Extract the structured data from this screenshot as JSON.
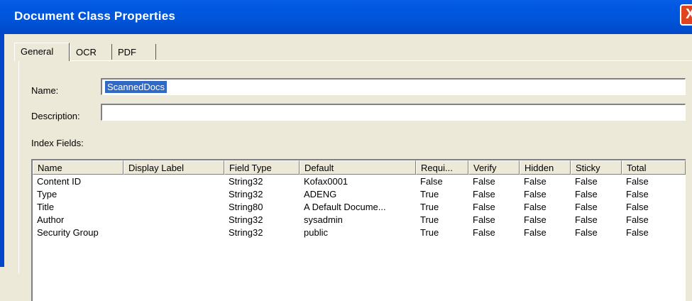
{
  "window": {
    "title": "Document Class Properties",
    "close_label": "X"
  },
  "tabs": [
    {
      "label": "General"
    },
    {
      "label": "OCR"
    },
    {
      "label": "PDF"
    }
  ],
  "form": {
    "name_label": "Name:",
    "name_value": "ScannedDocs",
    "description_label": "Description:",
    "description_value": "",
    "index_fields_label": "Index Fields:"
  },
  "table": {
    "columns": [
      "Name",
      "Display Label",
      "Field Type",
      "Default",
      "Requi...",
      "Verify",
      "Hidden",
      "Sticky",
      "Total"
    ],
    "rows": [
      [
        "Content ID",
        "",
        "String32",
        "Kofax0001",
        "False",
        "False",
        "False",
        "False",
        "False"
      ],
      [
        "Type",
        "",
        "String32",
        "ADENG",
        "True",
        "False",
        "False",
        "False",
        "False"
      ],
      [
        "Title",
        "",
        "String80",
        "A Default Docume...",
        "True",
        "False",
        "False",
        "False",
        "False"
      ],
      [
        "Author",
        "",
        "String32",
        "sysadmin",
        "True",
        "False",
        "False",
        "False",
        "False"
      ],
      [
        "Security Group",
        "",
        "String32",
        "public",
        "True",
        "False",
        "False",
        "False",
        "False"
      ]
    ]
  }
}
